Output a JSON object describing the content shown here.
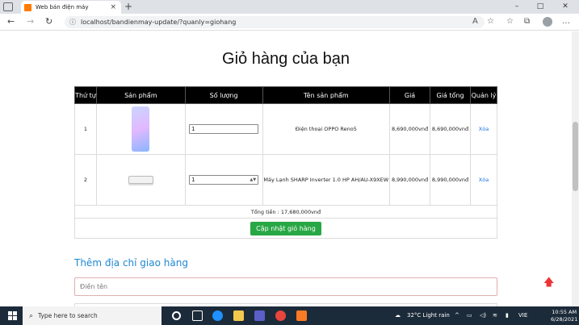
{
  "browser": {
    "tab_title": "Web bán điện máy",
    "tab_close": "×",
    "new_tab": "+",
    "url": "localhost/bandienmay-update/?quanly=giohang",
    "win_min": "–",
    "win_max": "□",
    "win_close": "✕"
  },
  "page": {
    "title": "Giỏ hàng của bạn",
    "columns": [
      "Thứ tự",
      "Sản phẩm",
      "Số lượng",
      "Tên sản phẩm",
      "Giá",
      "Giá tổng",
      "Quản lý"
    ],
    "rows": [
      {
        "index": "1",
        "qty": "1",
        "name": "Điện thoại OPPO Reno5",
        "price": "8,690,000vnđ",
        "total": "8,690,000vnđ",
        "action": "Xóa"
      },
      {
        "index": "2",
        "qty": "1",
        "name": "Máy Lạnh SHARP Inverter 1.0 HP AH/AU-X9XEW",
        "price": "8,990,000vnđ",
        "total": "8,990,000vnđ",
        "action": "Xóa"
      }
    ],
    "grand_total": "Tổng tiền : 17,680,000vnđ",
    "update_button": "Cập nhật giỏ hàng",
    "address_heading": "Thêm địa chỉ giao hàng",
    "name_placeholder": "Điền tên"
  },
  "taskbar": {
    "search_placeholder": "Type here to search",
    "weather": "32°C  Light rain",
    "lang": "VIE",
    "time": "10:55 AM",
    "date": "6/28/2021"
  }
}
